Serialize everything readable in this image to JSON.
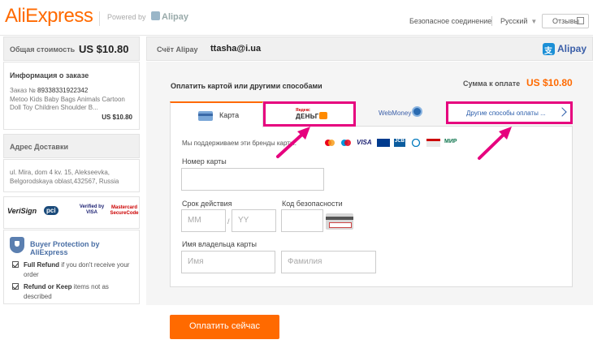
{
  "header": {
    "logo": "AliExpress",
    "powered_by": "Powered by",
    "powered_brand": "Alipay",
    "secure": "Безопасное соединение",
    "language": "Русский",
    "feedback": "Отзывы"
  },
  "sidebar": {
    "total_label": "Общая стоимость",
    "total_amount": "US $10.80",
    "order_title": "Информация о заказе",
    "order_number_label": "Заказ №",
    "order_number": "89338331922342",
    "order_desc": "Metoo Kids Baby Bags Animals Cartoon Doll Toy Children Shoulder B...",
    "order_price": "US $10.80",
    "address_title": "Адрес Доставки",
    "address": "ul. Mira, dom 4 kv. 15, Alekseevka, Belgorodskaya oblast,432567, Russia",
    "security_badges": [
      "VeriSign",
      "pci",
      "Verified by VISA",
      "Mastercard SecureCode"
    ],
    "protection_title": "Buyer Protection by AliExpress",
    "protection_items": [
      {
        "bold": "Full Refund",
        "rest": " if you don't receive your order"
      },
      {
        "bold": "Refund or Keep",
        "rest": " items not as described"
      }
    ]
  },
  "account": {
    "label": "Счёт Alipay",
    "email": "ttasha@i.ua",
    "brand": "Alipay"
  },
  "payment": {
    "title": "Оплатить картой или другими способами",
    "due_label": "Сумма к оплате",
    "due_amount": "US $10.80",
    "tabs": {
      "card": "Карта",
      "yandex_small": "Яндекс",
      "yandex_big": "ДЕНЬГИ",
      "webmoney": "WebMoney",
      "others": "Другие способы оплаты ..."
    },
    "brands_label": "Мы поддерживаем эти бренды карты:",
    "brands": [
      "VISA",
      "JCB",
      "МИР"
    ],
    "card_number_label": "Номер карты",
    "expiry_label": "Срок действия",
    "expiry_month_placeholder": "MM",
    "expiry_year_placeholder": "YY",
    "cvv_label": "Код безопасности",
    "holder_label": "Имя владельца карты",
    "first_name_placeholder": "Имя",
    "last_name_placeholder": "Фамилия",
    "pay_button": "Оплатить сейчас"
  },
  "colors": {
    "accent": "#ff6a00",
    "highlight": "#e6007e",
    "link": "#2a5caa"
  }
}
